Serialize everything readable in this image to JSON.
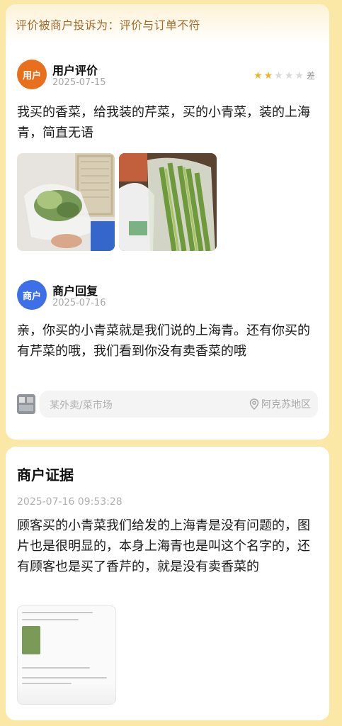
{
  "complaint": {
    "banner": "评价被商户投诉为：评价与订单不符"
  },
  "user_review": {
    "avatar_label": "用户",
    "title": "用户评价",
    "date": "2025-07-15",
    "rating": 2,
    "rating_max": 5,
    "rating_text": "差",
    "content": "我买的香菜，给我装的芹菜，买的小青菜，装的上海青，简直无语",
    "photos": [
      "review-photo-1",
      "review-photo-2"
    ]
  },
  "merchant_reply": {
    "avatar_label": "商户",
    "title": "商户回复",
    "date": "2025-07-16",
    "content": "亲，你买的小青菜就是我们说的上海青。还有你买的有芹菜的哦，我们看到你没有卖香菜的哦"
  },
  "store": {
    "name": "某外卖/菜市场",
    "location": "阿克苏地区",
    "location_icon": "location-pin-icon"
  },
  "evidence": {
    "title": "商户证据",
    "time": "2025-07-16 09:53:28",
    "content": "顾客买的小青菜我们给发的上海青是没有问题的，图片也是很明显的，本身上海青也是叫这个名字的，还有顾客也是买了香芹的，就是没有卖香菜的",
    "attachment": "evidence-screenshot"
  },
  "colors": {
    "page_bg": "#fbe7a6",
    "banner_text": "#a06a2c",
    "user_avatar": "#e8701d",
    "merchant_avatar": "#3d6fe6",
    "star_on": "#f0b32c",
    "star_off": "#d9d9d9"
  }
}
